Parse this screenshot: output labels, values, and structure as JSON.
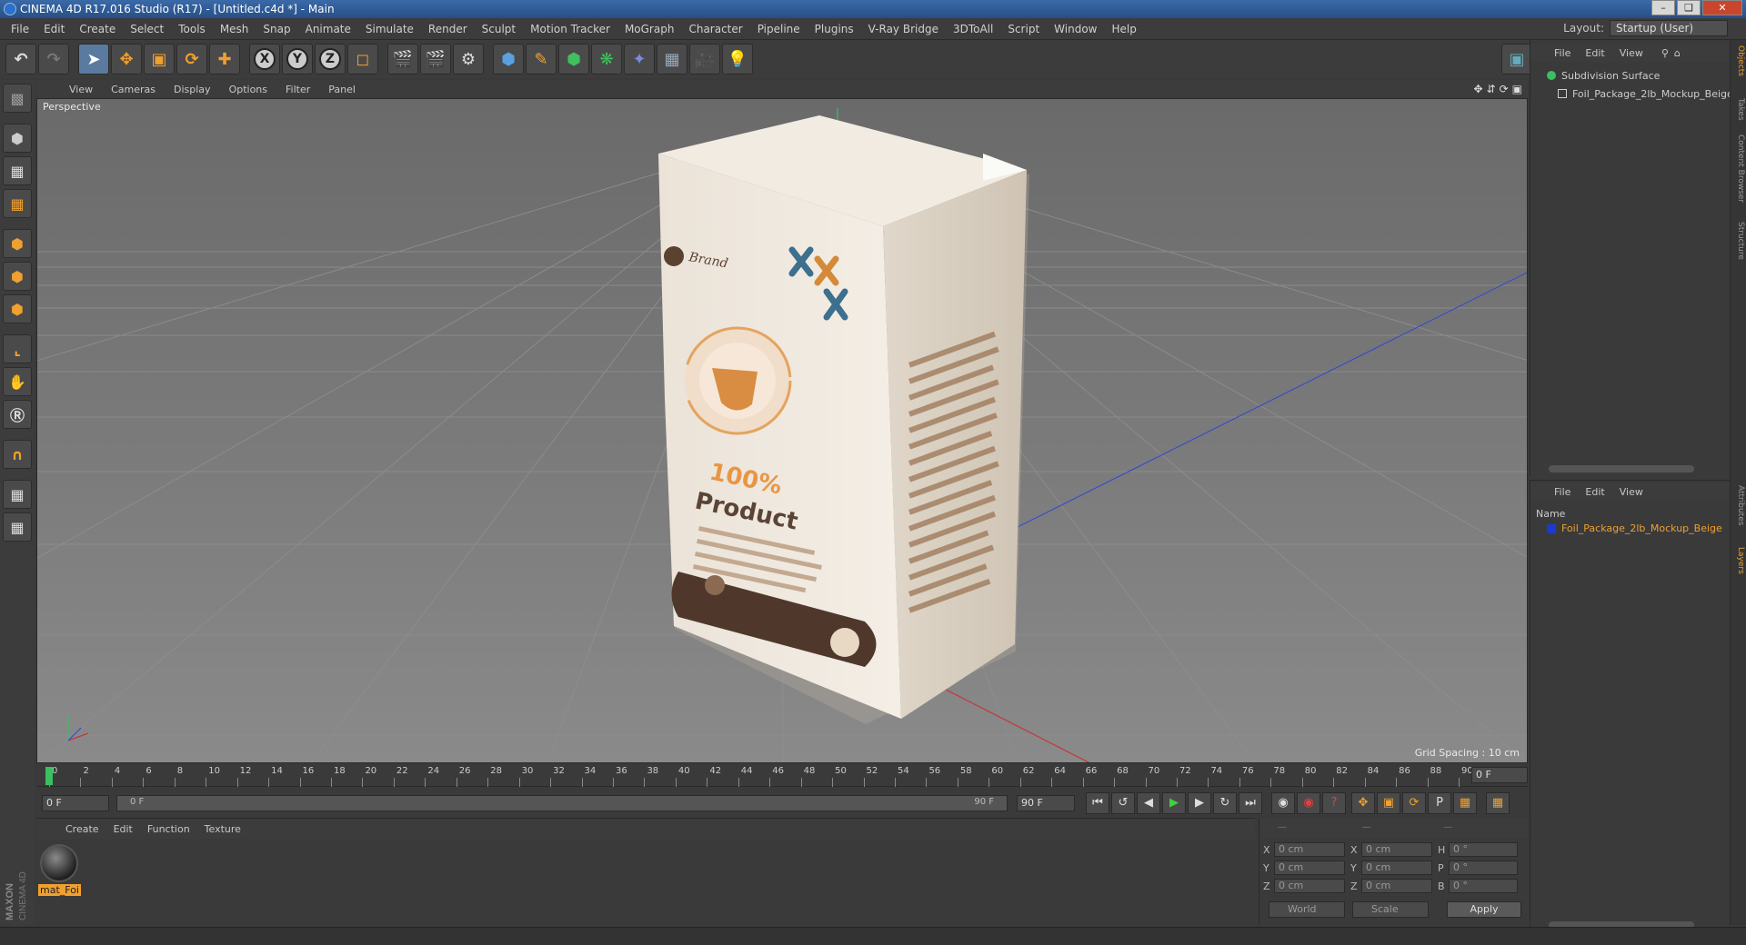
{
  "window": {
    "title": "CINEMA 4D R17.016 Studio (R17) - [Untitled.c4d *] - Main"
  },
  "menu": [
    "File",
    "Edit",
    "Create",
    "Select",
    "Tools",
    "Mesh",
    "Snap",
    "Animate",
    "Simulate",
    "Render",
    "Sculpt",
    "Motion Tracker",
    "MoGraph",
    "Character",
    "Pipeline",
    "Plugins",
    "V-Ray Bridge",
    "3DToAll",
    "Script",
    "Window",
    "Help"
  ],
  "layout": {
    "label": "Layout:",
    "value": "Startup (User)"
  },
  "viewport": {
    "menu": [
      "View",
      "Cameras",
      "Display",
      "Options",
      "Filter",
      "Panel"
    ],
    "label": "Perspective",
    "grid_spacing": "Grid Spacing : 10 cm"
  },
  "timeline": {
    "ticks": [
      "0",
      "2",
      "4",
      "6",
      "8",
      "10",
      "12",
      "14",
      "16",
      "18",
      "20",
      "22",
      "24",
      "26",
      "28",
      "30",
      "32",
      "34",
      "36",
      "38",
      "40",
      "42",
      "44",
      "46",
      "48",
      "50",
      "52",
      "54",
      "56",
      "58",
      "60",
      "62",
      "64",
      "66",
      "68",
      "70",
      "72",
      "74",
      "76",
      "78",
      "80",
      "82",
      "84",
      "86",
      "88",
      "90"
    ],
    "current_frame": "0 F"
  },
  "playback": {
    "start": "0 F",
    "range_start": "0 F",
    "range_end": "90 F",
    "end": "90 F"
  },
  "materials": {
    "menu": [
      "Create",
      "Edit",
      "Function",
      "Texture"
    ],
    "items": [
      {
        "name": "mat_Foi"
      }
    ]
  },
  "coordinates": {
    "rows": [
      {
        "a": "X",
        "av": "0 cm",
        "b": "X",
        "bv": "0 cm",
        "c": "H",
        "cv": "0 °"
      },
      {
        "a": "Y",
        "av": "0 cm",
        "b": "Y",
        "bv": "0 cm",
        "c": "P",
        "cv": "0 °"
      },
      {
        "a": "Z",
        "av": "0 cm",
        "b": "Z",
        "bv": "0 cm",
        "c": "B",
        "cv": "0 °"
      }
    ],
    "mode": "World",
    "scale": "Scale",
    "apply": "Apply"
  },
  "objects": {
    "menu": [
      "File",
      "Edit",
      "View"
    ],
    "items": [
      "Subdivision Surface",
      "Foil_Package_2lb_Mockup_Beige"
    ]
  },
  "layers": {
    "menu": [
      "File",
      "Edit",
      "View"
    ],
    "column": "Name",
    "items": [
      {
        "name": "Foil_Package_2lb_Mockup_Beige",
        "color": "#1a3ad0"
      }
    ]
  },
  "right_tabs": [
    "Objects",
    "Takes",
    "Content Browser",
    "Structure",
    "Attributes",
    "Layers"
  ],
  "package": {
    "brand": "Brand",
    "headline1": "100%",
    "headline2": "Product"
  },
  "colors": {
    "accent": "#f0a030",
    "layer_blue": "#1a3ad0"
  }
}
